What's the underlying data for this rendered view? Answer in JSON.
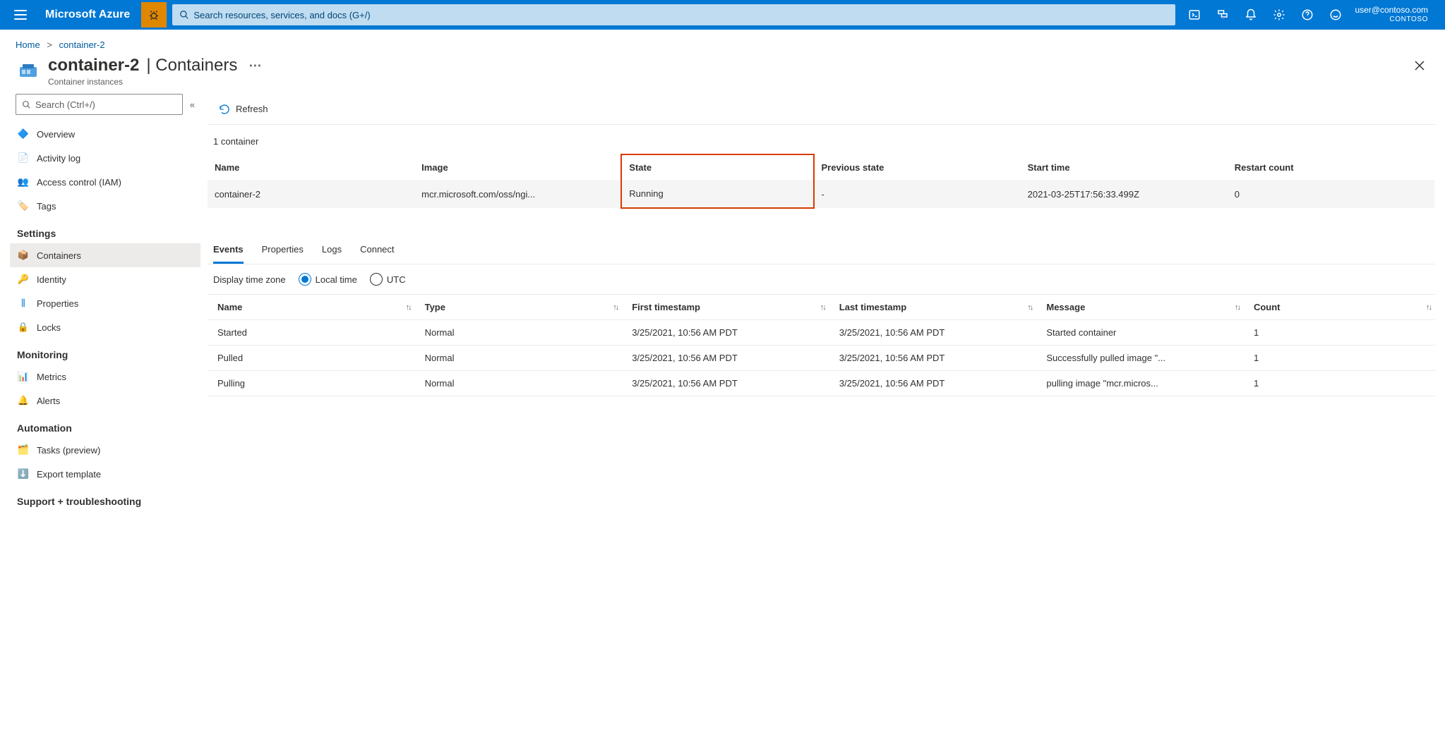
{
  "header": {
    "brand": "Microsoft Azure",
    "search_placeholder": "Search resources, services, and docs (G+/)",
    "user_email": "user@contoso.com",
    "user_directory": "CONTOSO"
  },
  "breadcrumb": {
    "home": "Home",
    "current": "container-2"
  },
  "blade": {
    "title_resource": "container-2",
    "title_section": "Containers",
    "subtitle": "Container instances"
  },
  "sidenav": {
    "search_placeholder": "Search (Ctrl+/)",
    "items_top": [
      {
        "label": "Overview"
      },
      {
        "label": "Activity log"
      },
      {
        "label": "Access control (IAM)"
      },
      {
        "label": "Tags"
      }
    ],
    "heading_settings": "Settings",
    "items_settings": [
      {
        "label": "Containers"
      },
      {
        "label": "Identity"
      },
      {
        "label": "Properties"
      },
      {
        "label": "Locks"
      }
    ],
    "heading_monitoring": "Monitoring",
    "items_monitoring": [
      {
        "label": "Metrics"
      },
      {
        "label": "Alerts"
      }
    ],
    "heading_automation": "Automation",
    "items_automation": [
      {
        "label": "Tasks (preview)"
      },
      {
        "label": "Export template"
      }
    ],
    "heading_support": "Support + troubleshooting"
  },
  "toolbar": {
    "refresh": "Refresh"
  },
  "container_summary": {
    "count_text": "1 container"
  },
  "container_table": {
    "headers": {
      "name": "Name",
      "image": "Image",
      "state": "State",
      "prev_state": "Previous state",
      "start": "Start time",
      "restart": "Restart count"
    },
    "row": {
      "name": "container-2",
      "image": "mcr.microsoft.com/oss/ngi...",
      "state": "Running",
      "prev_state": "-",
      "start": "2021-03-25T17:56:33.499Z",
      "restart": "0"
    }
  },
  "tabs": {
    "events": "Events",
    "properties": "Properties",
    "logs": "Logs",
    "connect": "Connect"
  },
  "timezone": {
    "label": "Display time zone",
    "local": "Local time",
    "utc": "UTC"
  },
  "events_table": {
    "headers": {
      "name": "Name",
      "type": "Type",
      "first": "First timestamp",
      "last": "Last timestamp",
      "message": "Message",
      "count": "Count"
    },
    "rows": [
      {
        "name": "Started",
        "type": "Normal",
        "first": "3/25/2021, 10:56 AM PDT",
        "last": "3/25/2021, 10:56 AM PDT",
        "message": "Started container",
        "count": "1"
      },
      {
        "name": "Pulled",
        "type": "Normal",
        "first": "3/25/2021, 10:56 AM PDT",
        "last": "3/25/2021, 10:56 AM PDT",
        "message": "Successfully pulled image \"...",
        "count": "1"
      },
      {
        "name": "Pulling",
        "type": "Normal",
        "first": "3/25/2021, 10:56 AM PDT",
        "last": "3/25/2021, 10:56 AM PDT",
        "message": "pulling image \"mcr.micros...",
        "count": "1"
      }
    ]
  }
}
